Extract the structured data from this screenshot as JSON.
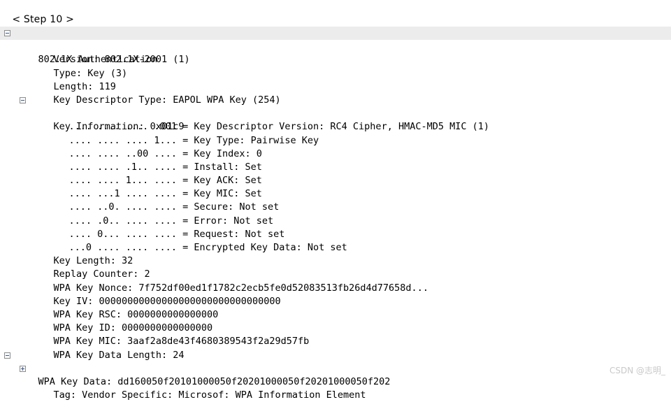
{
  "step_nav": {
    "prev_label": "<",
    "text": "Step 10",
    "next_label": ">",
    "full": "< Step 10 >"
  },
  "tree": {
    "protocol_header": "802.1X Authentication",
    "fields": [
      {
        "label": "Version: 802.1X-2001 (1)"
      },
      {
        "label": "Type: Key (3)"
      },
      {
        "label": "Length: 119"
      },
      {
        "label": "Key Descriptor Type: EAPOL WPA Key (254)"
      }
    ],
    "key_information": {
      "label": "Key Information: 0x01c9",
      "bits": [
        {
          "mask": ".... .... .... .001",
          "label": "= Key Descriptor Version: RC4 Cipher, HMAC-MD5 MIC (1)"
        },
        {
          "mask": ".... .... .... 1...",
          "label": "= Key Type: Pairwise Key"
        },
        {
          "mask": ".... .... ..00 ....",
          "label": "= Key Index: 0"
        },
        {
          "mask": ".... .... .1.. ....",
          "label": "= Install: Set"
        },
        {
          "mask": ".... .... 1... ....",
          "label": "= Key ACK: Set"
        },
        {
          "mask": ".... ...1 .... ....",
          "label": "= Key MIC: Set"
        },
        {
          "mask": ".... ..0. .... ....",
          "label": "= Secure: Not set"
        },
        {
          "mask": ".... .0.. .... ....",
          "label": "= Error: Not set"
        },
        {
          "mask": ".... 0... .... ....",
          "label": "= Request: Not set"
        },
        {
          "mask": "...0 .... .... ....",
          "label": "= Encrypted Key Data: Not set"
        }
      ]
    },
    "fields_after": [
      {
        "label": "Key Length: 32"
      },
      {
        "label": "Replay Counter: 2"
      },
      {
        "label": "WPA Key Nonce: 7f752df00ed1f1782c2ecb5fe0d52083513fb26d4d77658d..."
      },
      {
        "label": "Key IV: 00000000000000000000000000000000"
      },
      {
        "label": "WPA Key RSC: 0000000000000000"
      },
      {
        "label": "WPA Key ID: 0000000000000000"
      },
      {
        "label": "WPA Key MIC: 3aaf2a8de43f4680389543f2a29d57fb"
      },
      {
        "label": "WPA Key Data Length: 24"
      }
    ],
    "key_data": {
      "label": "WPA Key Data: dd160050f20101000050f20201000050f20201000050f202",
      "child": "Tag: Vendor Specific: Microsof: WPA Information Element"
    }
  },
  "watermark": "CSDN @志明_",
  "colors": {
    "background": "#ffffff",
    "text": "#000000",
    "highlight_row": "#ececec",
    "twisty_border": "#8c8c8c",
    "twisty_glyph": "#3a5a8c",
    "watermark": "#c9c9c9"
  }
}
